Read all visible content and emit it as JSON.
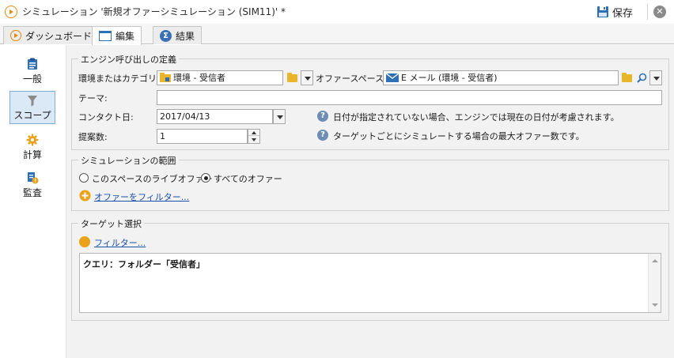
{
  "window": {
    "title": "シミュレーション '新規オファーシミュレーション (SIM11)' *",
    "save_label": "保存"
  },
  "tabs": [
    {
      "label": "ダッシュボード",
      "icon": "play-icon"
    },
    {
      "label": "編集",
      "icon": "edit-icon",
      "active": true
    },
    {
      "label": "結果",
      "icon": "sigma-icon"
    }
  ],
  "sidebar": {
    "items": [
      {
        "label": "一般",
        "icon": "clipboard-icon"
      },
      {
        "label": "スコープ",
        "icon": "funnel-icon",
        "active": true
      },
      {
        "label": "計算",
        "icon": "gear-icon"
      },
      {
        "label": "監査",
        "icon": "audit-icon"
      }
    ]
  },
  "engine": {
    "legend": "エンジン呼び出しの定義",
    "env_label": "環境またはカテゴリ:",
    "env_value": "環境 - 受信者",
    "space_label": "オファースペース:",
    "space_value": "E メール (環境 - 受信者)",
    "theme_label": "テーマ:",
    "theme_value": "",
    "contact_label": "コンタクト日:",
    "contact_value": "2017/04/13",
    "contact_help": "日付が指定されていない場合、エンジンでは現在の日付が考慮されます。",
    "proposals_label": "提案数:",
    "proposals_value": "1",
    "proposals_help": "ターゲットごとにシミュレートする場合の最大オファー数です。"
  },
  "scope": {
    "legend": "シミュレーションの範囲",
    "option_live": "このスペースのライブオファー",
    "option_all": "すべてのオファー",
    "selected": "all",
    "filter_link": "オファーをフィルター..."
  },
  "target": {
    "legend": "ターゲット選択",
    "filter_link": "フィルター...",
    "query_text": "クエリ：フォルダー「受信者」"
  },
  "colors": {
    "accent_orange": "#e38a0c",
    "link_blue": "#1a4fa8",
    "active_nav_bg": "#dbe8f6",
    "panel_bg": "#f2f2f2"
  }
}
